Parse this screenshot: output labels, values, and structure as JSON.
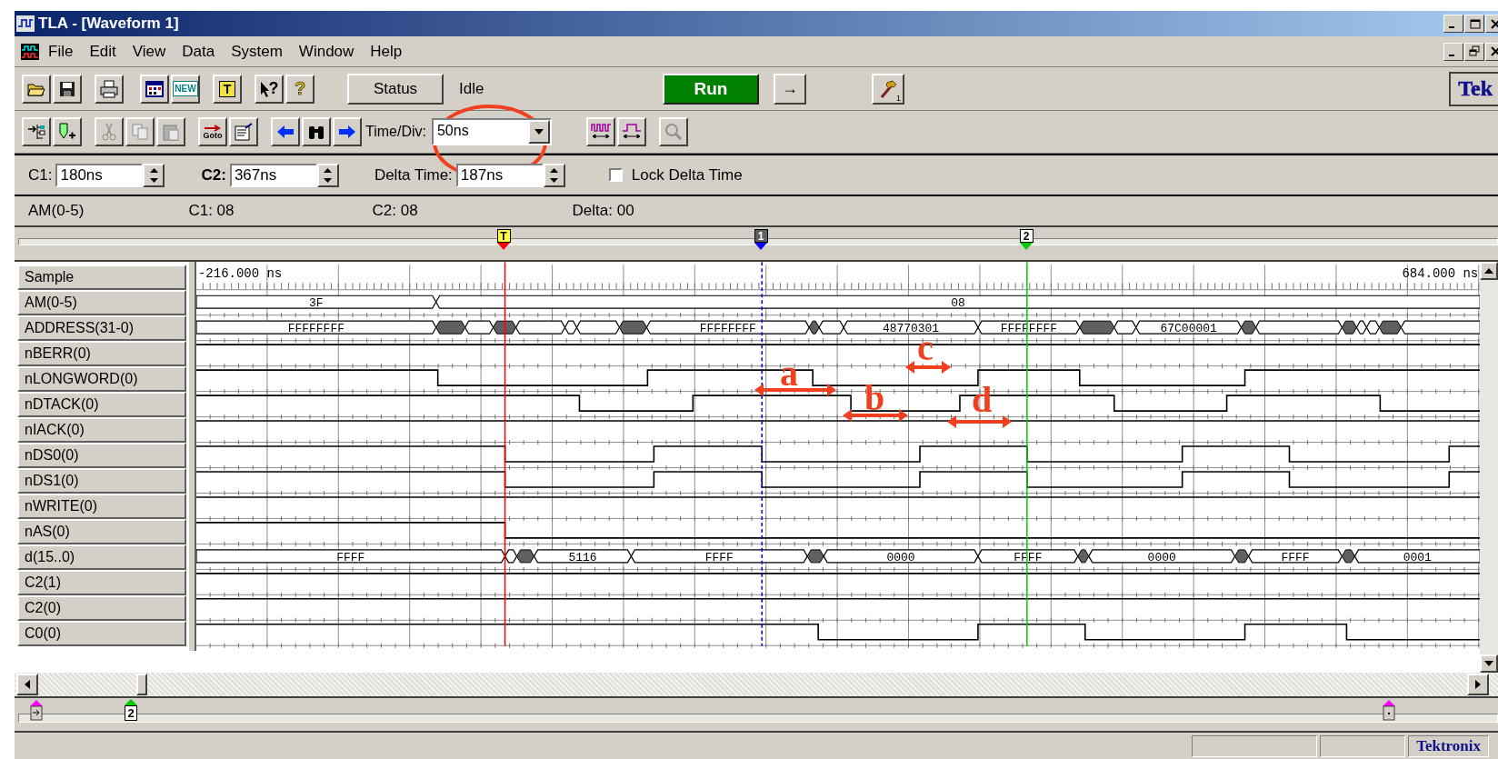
{
  "window": {
    "title": "TLA - [Waveform 1]"
  },
  "menu": [
    "File",
    "Edit",
    "View",
    "Data",
    "System",
    "Window",
    "Help"
  ],
  "toolbar": {
    "glyphs": [
      "NEW",
      "T",
      "?",
      "?"
    ],
    "status_button": "Status",
    "status": "Idle",
    "run_button": "Run",
    "arrow_button": "→",
    "hammer_badge": "1",
    "logo": "Tek"
  },
  "toolbar2": {
    "glyphs": [
      "Goto"
    ],
    "time_div_label": "Time/Div:",
    "time_div_value": "50ns"
  },
  "cursors": {
    "c1_label": "C1:",
    "c1_value": "180ns",
    "c2_label": "C2:",
    "c2_value": "367ns",
    "delta_label": "Delta Time:",
    "delta_value": "187ns",
    "lock": {
      "label": "Lock Delta Time",
      "checked": false
    }
  },
  "readout": [
    "AM(0-5)",
    "C1: 08",
    "C2: 08",
    "Delta: 00"
  ],
  "markers": [
    {
      "label": "T",
      "color": "#ff0000"
    },
    {
      "label": "1",
      "color": "#0000ff"
    },
    {
      "label": "2",
      "color": "#00cc00"
    }
  ],
  "signals": [
    {
      "name": "Sample",
      "kind": "ruler",
      "start": "-216.000 ns",
      "end": "684.000 ns"
    },
    {
      "name": "AM(0-5)",
      "kind": "bus",
      "values": [
        "3F",
        "08"
      ]
    },
    {
      "name": "ADDRESS(31-0)",
      "kind": "bus",
      "values": [
        "FFFFFFFF",
        "FFFFFFFF",
        "48770301",
        "FFFFFFFF",
        "67C00001"
      ]
    },
    {
      "name": "nBERR(0)",
      "kind": "bit"
    },
    {
      "name": "nLONGWORD(0)",
      "kind": "bit"
    },
    {
      "name": "nDTACK(0)",
      "kind": "bit"
    },
    {
      "name": "nIACK(0)",
      "kind": "bit"
    },
    {
      "name": "nDS0(0)",
      "kind": "bit"
    },
    {
      "name": "nDS1(0)",
      "kind": "bit"
    },
    {
      "name": "nWRITE(0)",
      "kind": "bit"
    },
    {
      "name": "nAS(0)",
      "kind": "bit"
    },
    {
      "name": "d(15..0)",
      "kind": "bus",
      "values": [
        "FFFF",
        "5116",
        "FFFF",
        "0000",
        "FFFF",
        "0000",
        "FFFF",
        "0001"
      ]
    },
    {
      "name": "C2(1)",
      "kind": "bit"
    },
    {
      "name": "C2(0)",
      "kind": "bit"
    },
    {
      "name": "C0(0)",
      "kind": "bit"
    }
  ],
  "overview": {
    "markers": [
      {
        "label": "2"
      }
    ]
  },
  "status_bar": {
    "logo": "Tektronix"
  },
  "annotations": [
    {
      "label": "a"
    },
    {
      "label": "b"
    },
    {
      "label": "c"
    },
    {
      "label": "d"
    }
  ]
}
